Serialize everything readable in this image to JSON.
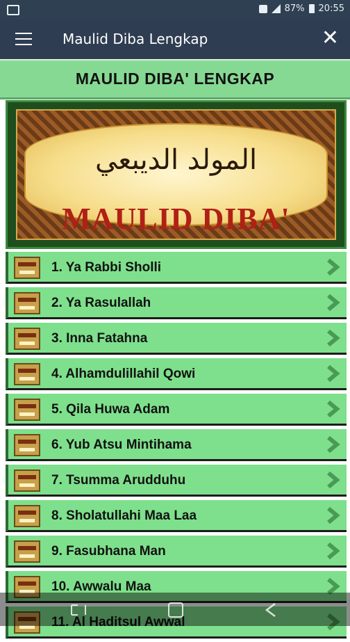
{
  "status_bar": {
    "battery": "87%",
    "time": "20:55",
    "notification_icon": "gallery-icon"
  },
  "app_bar": {
    "title": "Maulid Diba Lengkap",
    "menu_icon": "menu-icon",
    "close_label": "✕"
  },
  "banner": {
    "heading": "MAULID DIBA' LENGKAP"
  },
  "hero": {
    "arabic_title": "المولد الديبعي",
    "latin_title": "MAULID DIBA'"
  },
  "chapters": [
    {
      "label": "1. Ya Rabbi Sholli"
    },
    {
      "label": "2. Ya Rasulallah"
    },
    {
      "label": "3. Inna Fatahna"
    },
    {
      "label": "4. Alhamdulillahil Qowi"
    },
    {
      "label": "5. Qila Huwa Adam"
    },
    {
      "label": "6. Yub Atsu Mintihama"
    },
    {
      "label": "7. Tsumma Arudduhu"
    },
    {
      "label": "8. Sholatullahi Maa Laa"
    },
    {
      "label": "9. Fasubhana Man"
    },
    {
      "label": "10. Awwalu Maa"
    },
    {
      "label": "11. Al Haditsul Awwal"
    }
  ],
  "colors": {
    "app_bar": "#2f3d52",
    "banner": "#86d993",
    "list_item": "#7ee08c",
    "hero_red": "#b02015"
  },
  "nav_bar": {
    "icons": [
      "recent-apps-icon",
      "home-icon",
      "back-icon"
    ]
  }
}
